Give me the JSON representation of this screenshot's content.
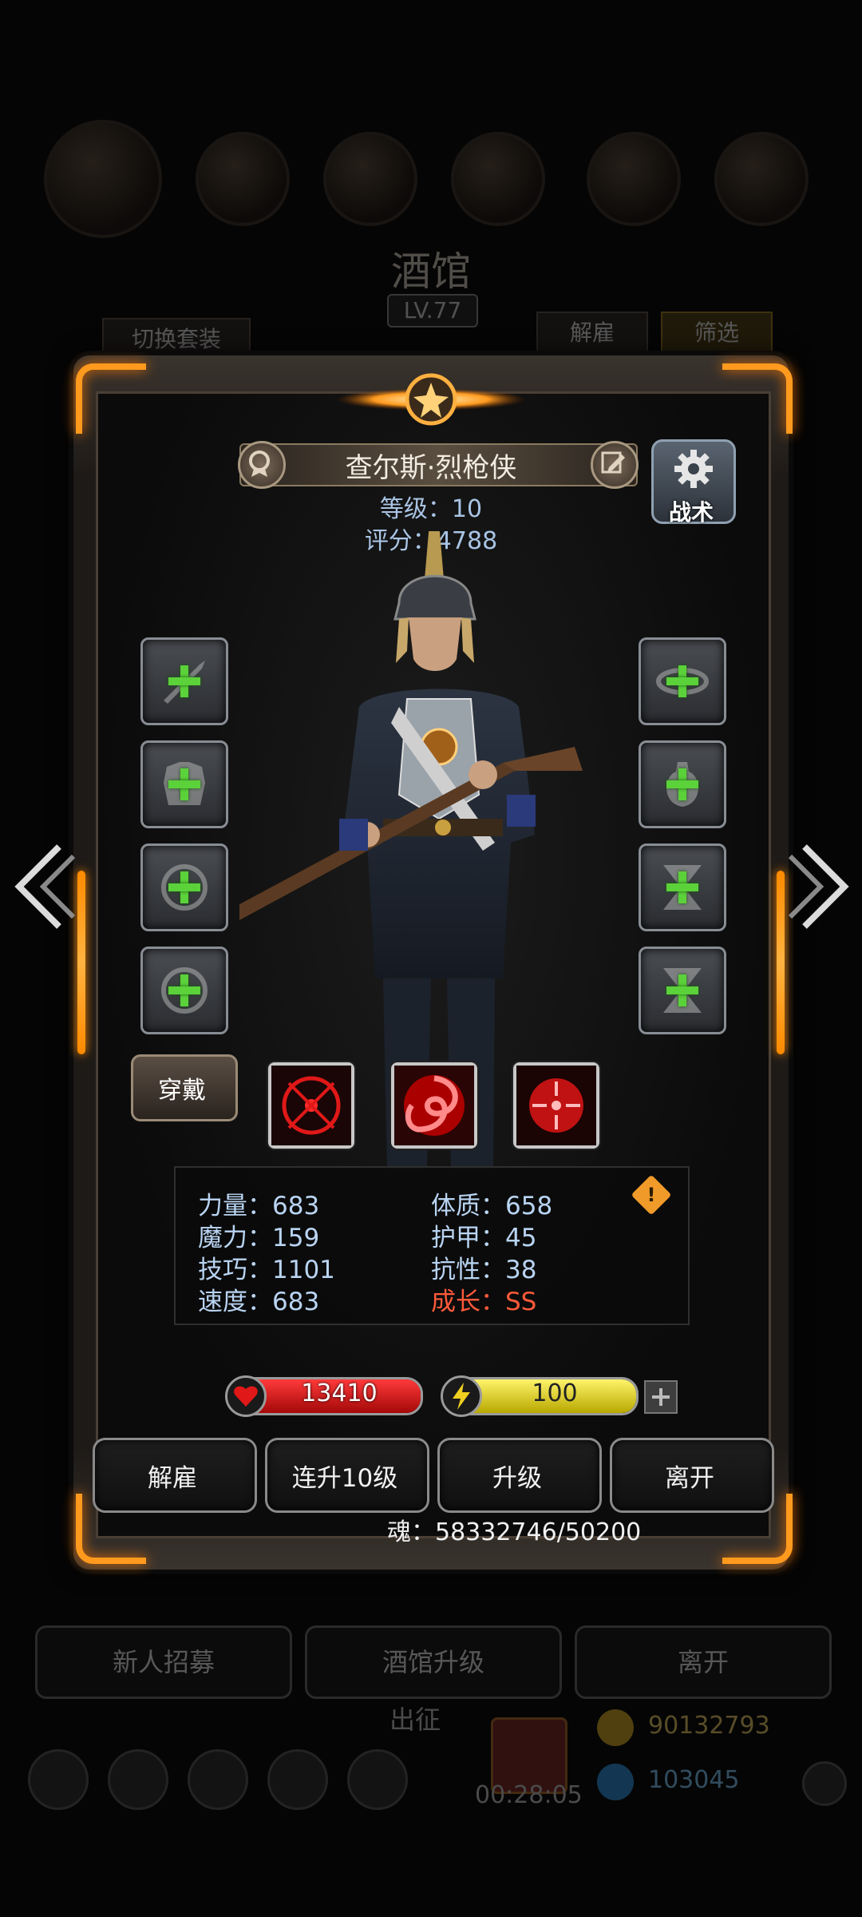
{
  "background": {
    "title": "酒馆",
    "level": "LV.77",
    "switch_outfit": "切换套装",
    "dismiss": "解雇",
    "filter": "筛选",
    "timer_top": "00:28:05",
    "recruit": "新人招募",
    "upgrade_tavern": "酒馆升级",
    "leave": "离开",
    "expedition": "出征",
    "timer_bottom": "00:28:05",
    "gold": "90132793",
    "gems": "103045"
  },
  "hero": {
    "name": "查尔斯·烈枪侠",
    "level_label": "等级：10",
    "score_label": "评分：4788",
    "tactics_label": "战术",
    "wear_label": "穿戴"
  },
  "stats": {
    "strength": "力量：683",
    "magic": "魔力：159",
    "skill": "技巧：1101",
    "speed": "速度：683",
    "constitution": "体质：658",
    "armor": "护甲：45",
    "resistance": "抗性：38",
    "growth": "成长：SS"
  },
  "bars": {
    "hp": "13410",
    "energy": "100"
  },
  "actions": {
    "dismiss": "解雇",
    "level10": "连升10级",
    "upgrade": "升级",
    "leave": "离开"
  },
  "soul": "魂：58332746/50200",
  "colors": {
    "accent_orange": "#ff9a1e",
    "hp_red": "#d81818",
    "energy_yellow": "#e8e020",
    "stat_blue": "#b9d4f2",
    "growth_red": "#ff5a3a"
  }
}
